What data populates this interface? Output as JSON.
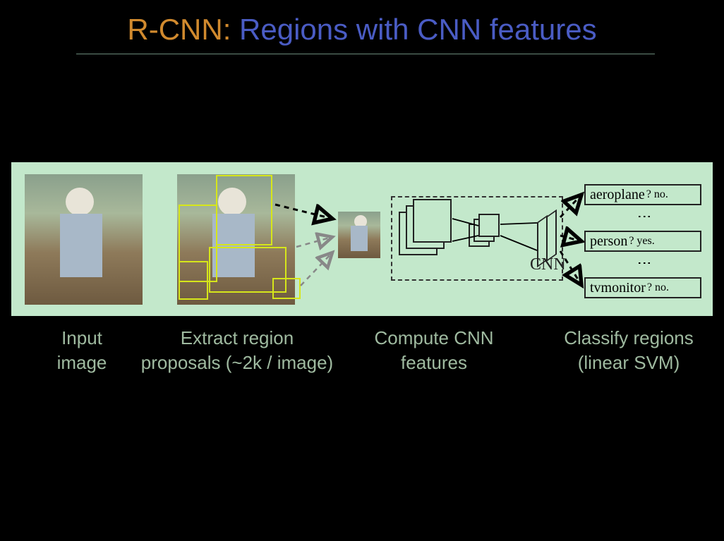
{
  "title": {
    "prefix": "R-CNN:",
    "rest": " Regions with CNN features"
  },
  "diagram": {
    "cnn_label": "CNN",
    "classifiers": [
      {
        "label": "aeroplane",
        "answer": "? no."
      },
      {
        "label": "person",
        "answer": "? yes."
      },
      {
        "label": "tvmonitor",
        "answer": "? no."
      }
    ]
  },
  "captions": {
    "input": "Input image",
    "proposals": "Extract region proposals (~2k / image)",
    "compute": "Compute CNN features",
    "classify": "Classify regions (linear SVM)"
  }
}
